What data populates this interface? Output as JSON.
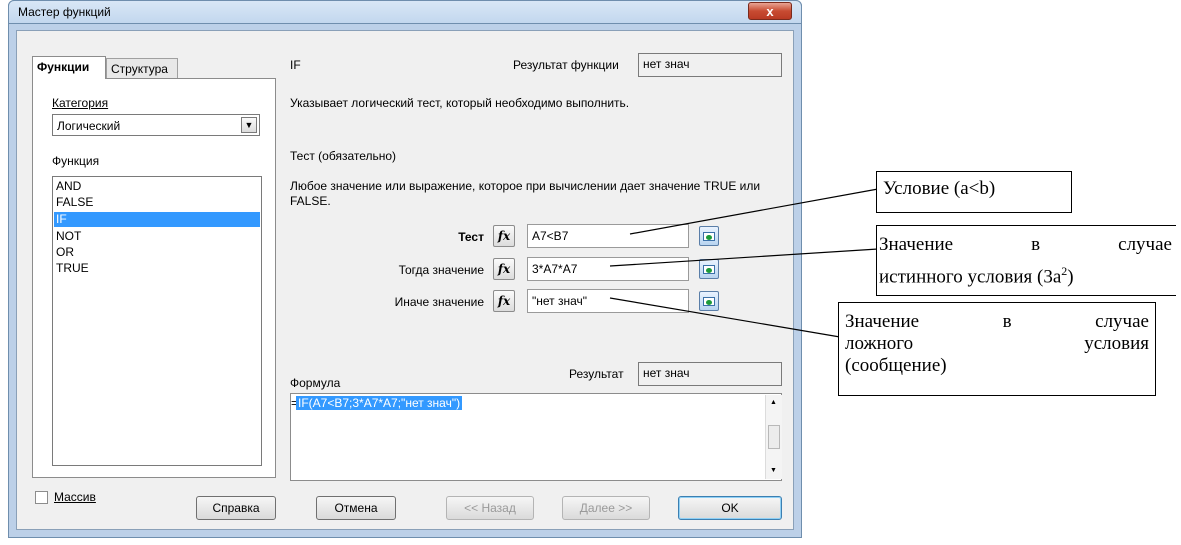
{
  "window": {
    "title": "Мастер функций",
    "close": "x"
  },
  "tabs": {
    "functions": "Функции",
    "structure": "Структура"
  },
  "left": {
    "category_label": "Категория",
    "category_value": "Логический",
    "function_label": "Функция",
    "functions": [
      "AND",
      "FALSE",
      "IF",
      "NOT",
      "OR",
      "TRUE"
    ],
    "selected_function": "IF",
    "array_label": "Массив"
  },
  "right": {
    "function_name": "IF",
    "func_result_label": "Результат функции",
    "func_result_value": "нет знач",
    "description": "Указывает логический тест, который необходимо выполнить.",
    "param_title": "Тест (обязательно)",
    "param_desc": "Любое значение или выражение, которое при вычислении дает значение TRUE или FALSE.",
    "params": [
      {
        "label": "Тест",
        "value": "A7<B7"
      },
      {
        "label": "Тогда значение",
        "value": "3*A7*A7"
      },
      {
        "label": "Иначе значение",
        "value": "\"нет знач\""
      }
    ],
    "formula_label": "Формула",
    "result_label": "Результат",
    "result_value": "нет знач",
    "formula_prefix": "=",
    "formula_text": "IF(A7<B7;3*A7*A7;\"нет знач\")"
  },
  "buttons": {
    "help": "Справка",
    "cancel": "Отмена",
    "back": "<< Назад",
    "next": "Далее >>",
    "ok": "OK"
  },
  "annotations": {
    "condition": "Условие (a<b)",
    "true_line1_left": "Значение",
    "true_line1_mid": "в",
    "true_line1_right": "случае",
    "true_line2": "истинного условия (3a",
    "true_sup": "2",
    "true_close": ")",
    "false_line1_left": "Значение",
    "false_line1_mid": "в",
    "false_line1_right": "случае",
    "false_line2_left": "ложного",
    "false_line2_right": "условия",
    "false_line3": "(сообщение)"
  }
}
